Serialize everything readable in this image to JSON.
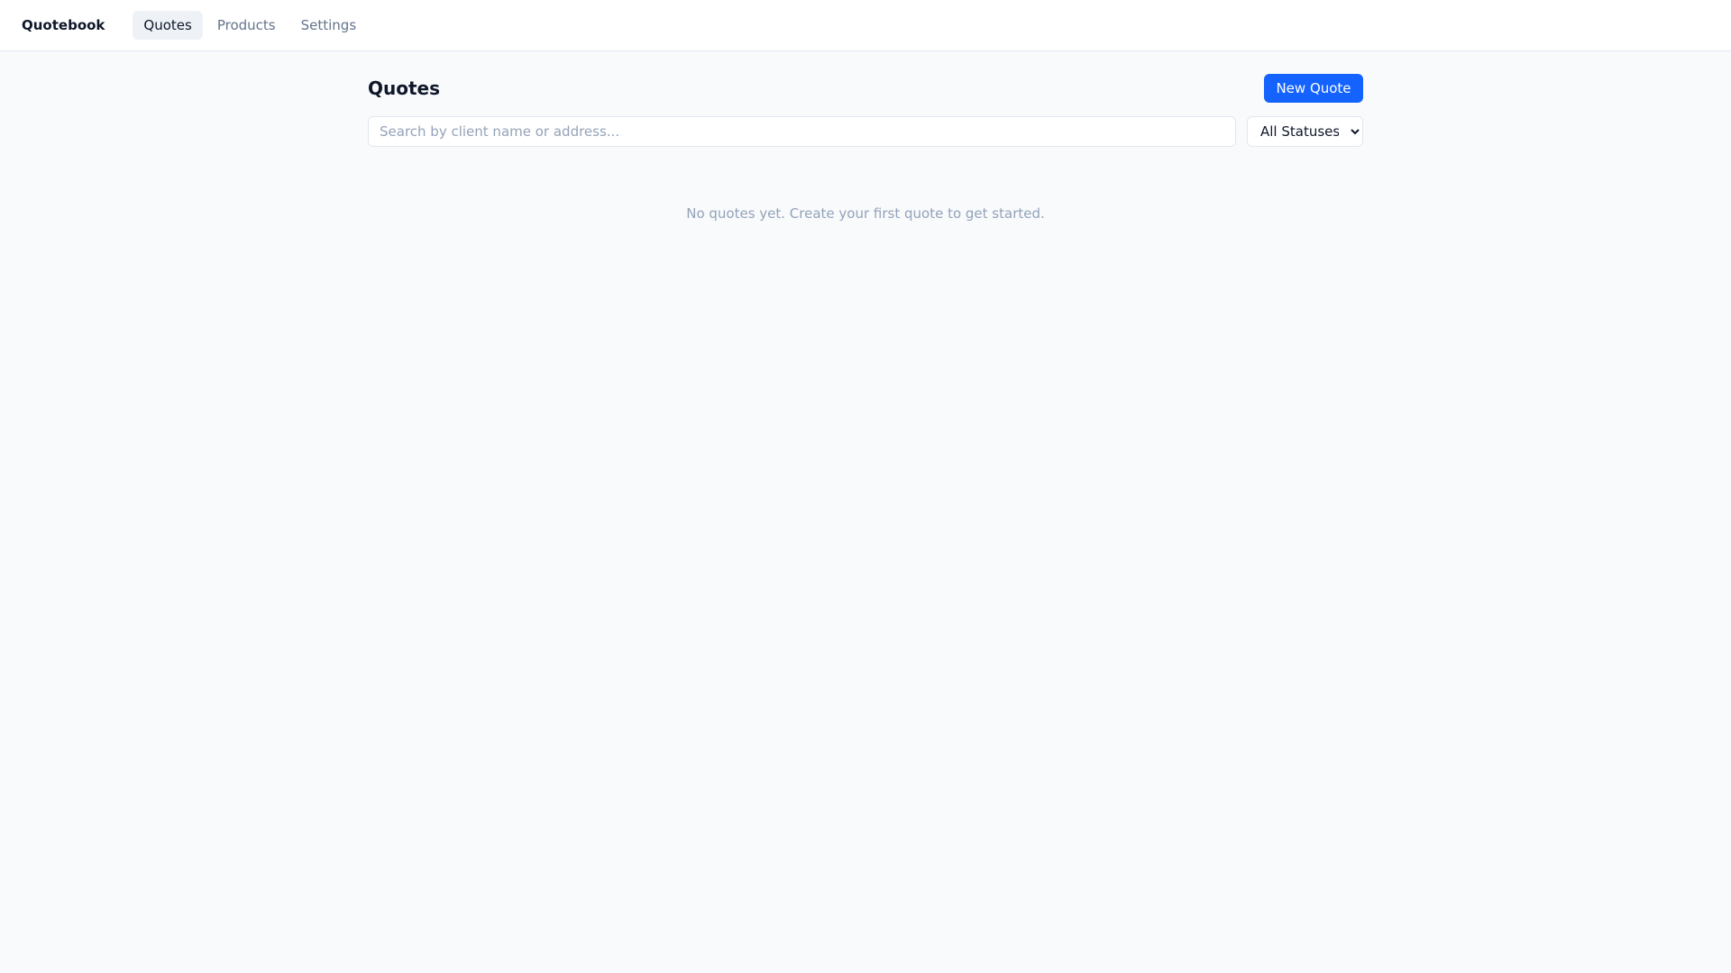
{
  "app": {
    "name": "Quotebook"
  },
  "nav": [
    {
      "label": "Quotes",
      "active": true
    },
    {
      "label": "Products"
    },
    {
      "label": "Settings"
    }
  ],
  "page": {
    "title": "Quotes",
    "new_button": "New Quote"
  },
  "search": {
    "placeholder": "Search by client name or address...",
    "value": ""
  },
  "status_filter": {
    "selected": "All Statuses"
  },
  "empty_message": "No quotes yet. Create your first quote to get started.",
  "colors": {
    "accent": "#1463ff",
    "background": "#f8fafc"
  }
}
